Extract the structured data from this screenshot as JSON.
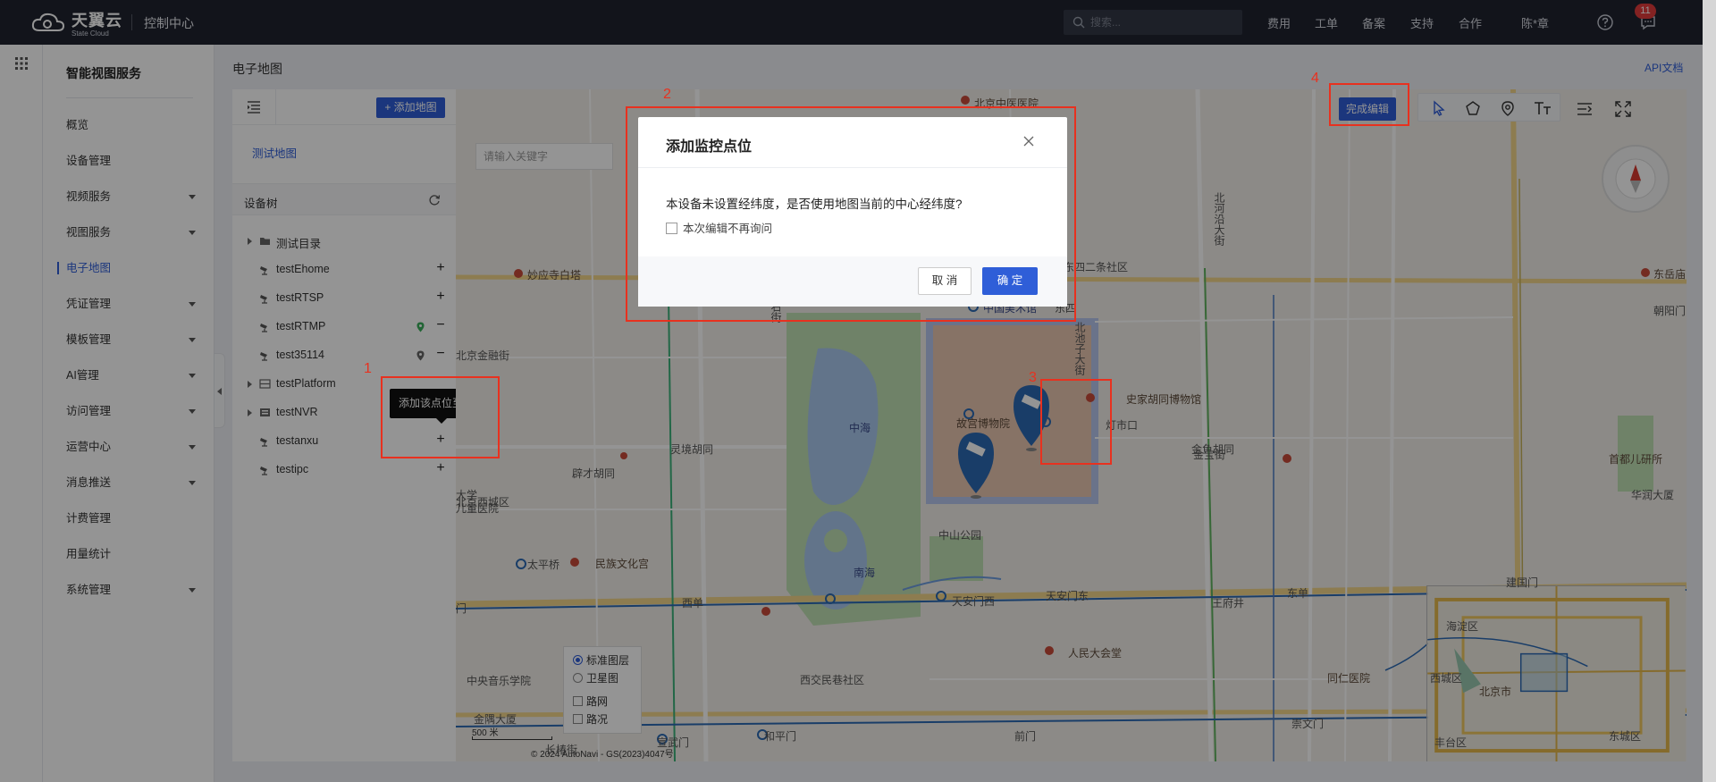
{
  "topbar": {
    "logo_main": "天翼云",
    "logo_sub": "State Cloud",
    "console_title": "控制中心",
    "search_placeholder": "搜索...",
    "nav": [
      "费用",
      "工单",
      "备案",
      "支持",
      "合作"
    ],
    "user": "陈*章",
    "message_count": "11"
  },
  "sidemenu": {
    "title": "智能视图服务",
    "items": [
      {
        "label": "概览",
        "expandable": false
      },
      {
        "label": "设备管理",
        "expandable": false
      },
      {
        "label": "视频服务",
        "expandable": true
      },
      {
        "label": "视图服务",
        "expandable": true
      },
      {
        "label": "电子地图",
        "expandable": false,
        "active": true
      },
      {
        "label": "凭证管理",
        "expandable": true
      },
      {
        "label": "模板管理",
        "expandable": true
      },
      {
        "label": "AI管理",
        "expandable": true
      },
      {
        "label": "访问管理",
        "expandable": true
      },
      {
        "label": "运营中心",
        "expandable": true
      },
      {
        "label": "消息推送",
        "expandable": true
      },
      {
        "label": "计费管理",
        "expandable": false
      },
      {
        "label": "用量统计",
        "expandable": false
      },
      {
        "label": "系统管理",
        "expandable": true
      }
    ]
  },
  "main": {
    "page_title": "电子地图",
    "api_link": "API文档"
  },
  "panel": {
    "add_map_button": "+ 添加地图",
    "map_name": "测试地图",
    "tree_title": "设备树",
    "tree": [
      {
        "label": "测试目录",
        "icon": "folder-icon",
        "expandable": true,
        "action": ""
      },
      {
        "label": "testEhome",
        "icon": "camera-icon",
        "expandable": false,
        "action": "+"
      },
      {
        "label": "testRTSP",
        "icon": "camera-icon",
        "expandable": false,
        "action": "+"
      },
      {
        "label": "testRTMP",
        "icon": "camera-icon",
        "expandable": false,
        "action": "−",
        "pinned": true,
        "pin_color": "#3cae5c"
      },
      {
        "label": "test35114",
        "icon": "camera-icon",
        "expandable": false,
        "action": "−",
        "pinned": true,
        "pin_color": "#666666"
      },
      {
        "label": "testPlatform",
        "icon": "platform-icon",
        "expandable": true,
        "action": ""
      },
      {
        "label": "testNVR",
        "icon": "nvr-icon",
        "expandable": true,
        "action": ""
      },
      {
        "label": "testanxu",
        "icon": "camera-icon",
        "expandable": false,
        "action": "+"
      },
      {
        "label": "testipc",
        "icon": "camera-icon",
        "expandable": false,
        "action": "+"
      }
    ],
    "tooltip": "添加该点位至地图"
  },
  "map": {
    "finish_edit_button": "完成编辑",
    "search_placeholder": "请输入关键字",
    "layers": {
      "standard": "标准图层",
      "satellite": "卫星图",
      "roads": "路网",
      "traffic": "路况",
      "selected": "标准图层"
    },
    "scale": "500 米",
    "copyright": "© 2024 AutoNavi - GS(2023)4047号",
    "labels": [
      {
        "text": "北京中医医院",
        "cls": "dark"
      },
      {
        "text": "妙应寺白塔",
        "cls": "dark"
      },
      {
        "text": "中国美术馆",
        "cls": "dark"
      },
      {
        "text": "中国美术馆",
        "cls": "blue"
      },
      {
        "text": "东四",
        "cls": ""
      },
      {
        "text": "东四二条社区",
        "cls": ""
      },
      {
        "text": "朝阳门",
        "cls": ""
      },
      {
        "text": "东岳庙",
        "cls": "dark"
      },
      {
        "text": "北京金融街",
        "cls": ""
      },
      {
        "text": "北京西城区",
        "cls": ""
      },
      {
        "text": "府右街",
        "cls": ""
      },
      {
        "text": "中海",
        "cls": "blue"
      },
      {
        "text": "故宫博物院",
        "cls": "dark"
      },
      {
        "text": "北池子大街",
        "cls": ""
      },
      {
        "text": "史家胡同博物馆",
        "cls": "dark"
      },
      {
        "text": "灯市口",
        "cls": ""
      },
      {
        "text": "金鱼胡同",
        "cls": ""
      },
      {
        "text": "金宝街",
        "cls": ""
      },
      {
        "text": "首都儿研所",
        "cls": "dark"
      },
      {
        "text": "华润大厦",
        "cls": ""
      },
      {
        "text": "灵境胡同",
        "cls": ""
      },
      {
        "text": "辟才胡同",
        "cls": ""
      },
      {
        "text": "大学",
        "cls": ""
      },
      {
        "text": "儿童医院",
        "cls": ""
      },
      {
        "text": "中山公园",
        "cls": ""
      },
      {
        "text": "南海",
        "cls": "blue"
      },
      {
        "text": "太平桥",
        "cls": ""
      },
      {
        "text": "民族文化宫",
        "cls": "dark"
      },
      {
        "text": "西单",
        "cls": ""
      },
      {
        "text": "天安门西",
        "cls": ""
      },
      {
        "text": "天安门东",
        "cls": ""
      },
      {
        "text": "王府井",
        "cls": ""
      },
      {
        "text": "东单",
        "cls": ""
      },
      {
        "text": "建国门",
        "cls": ""
      },
      {
        "text": "人民大会堂",
        "cls": "dark"
      },
      {
        "text": "中央音乐学院",
        "cls": ""
      },
      {
        "text": "西交民巷社区",
        "cls": ""
      },
      {
        "text": "同仁医院",
        "cls": "dark"
      },
      {
        "text": "金隅大厦",
        "cls": ""
      },
      {
        "text": "宣武门",
        "cls": ""
      },
      {
        "text": "和平门",
        "cls": ""
      },
      {
        "text": "前门",
        "cls": ""
      },
      {
        "text": "崇文门",
        "cls": ""
      },
      {
        "text": "长椿街",
        "cls": ""
      },
      {
        "text": "海淀区",
        "cls": ""
      },
      {
        "text": "西城区",
        "cls": ""
      },
      {
        "text": "北京市",
        "cls": "dark"
      },
      {
        "text": "丰台区",
        "cls": ""
      },
      {
        "text": "东城区",
        "cls": ""
      },
      {
        "text": "门",
        "cls": ""
      },
      {
        "text": "北河沿大街",
        "cls": ""
      }
    ]
  },
  "dialog": {
    "title": "添加监控点位",
    "message": "本设备未设置经纬度，是否使用地图当前的中心经纬度?",
    "checkbox_label": "本次编辑不再询问",
    "cancel": "取 消",
    "ok": "确 定"
  },
  "annotations": [
    "1",
    "2",
    "3",
    "4"
  ],
  "colors": {
    "accent": "#2f5ed8",
    "annotation": "#e8311f",
    "topbar": "#1f2330"
  }
}
